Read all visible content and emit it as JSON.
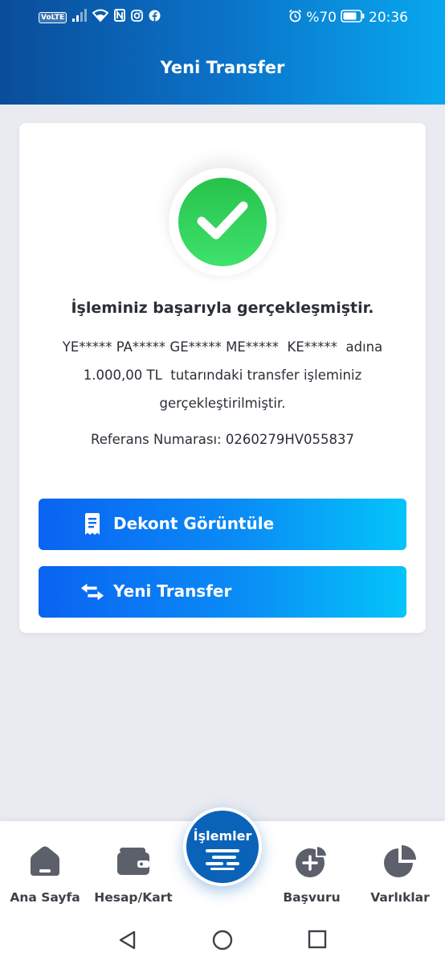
{
  "status_bar": {
    "volte": "VoLTE",
    "battery": "%70",
    "time": "20:36"
  },
  "header": {
    "title": "Yeni Transfer"
  },
  "result": {
    "icon": "check-icon",
    "title": "İşleminiz başarıyla gerçekleşmiştir.",
    "message_line1": "YE***** PA***** GE***** ME*****  KE*****  adına",
    "message_line2": "1.000,00 TL  tutarındaki transfer işleminiz",
    "message_line3": "gerçekleştirilmiştir.",
    "reference": "Referans Numarası: 0260279HV055837"
  },
  "actions": {
    "receipt_label": "Dekont Görüntüle",
    "new_transfer_label": "Yeni Transfer"
  },
  "bottom_nav": {
    "home": "Ana Sayfa",
    "account_card": "Hesap/Kart",
    "transactions": "İşlemler",
    "application": "Başvuru",
    "assets": "Varlıklar"
  },
  "colors": {
    "header_start": "#0a4d99",
    "header_end": "#08a8ee",
    "success_green": "#2ecc55",
    "button_start": "#0a63f2",
    "button_end": "#04c4fa",
    "fab_blue": "#0a63b8"
  }
}
